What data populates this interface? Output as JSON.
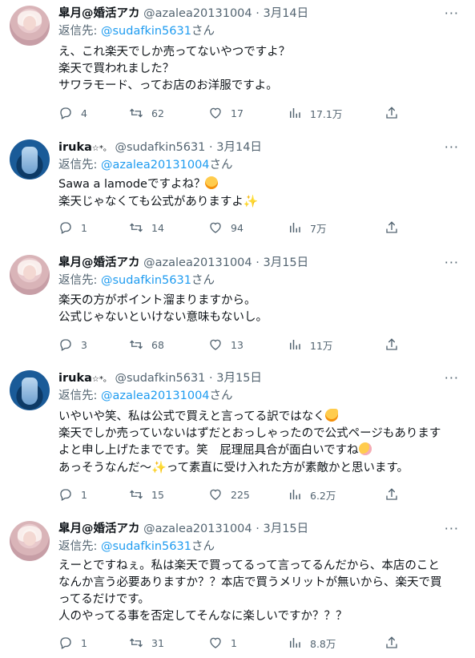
{
  "tweets": [
    {
      "name": "皐月@婚活アカ",
      "handle": "@azalea20131004",
      "date": "3月14日",
      "reply_prefix": "返信先: ",
      "reply_to": "@sudafkin5631",
      "reply_suffix": "さん",
      "lines": [
        "え、これ楽天でしか売ってないやつですよ？",
        "楽天で買われました？",
        "サワラモード、ってお店のお洋服ですよ。"
      ],
      "replies": "4",
      "retweets": "62",
      "likes": "17",
      "views": "17.1万"
    },
    {
      "name": "iruka",
      "name_suffix": "☆*。",
      "handle": "@sudafkin5631",
      "date": "3月14日",
      "reply_prefix": "返信先: ",
      "reply_to": "@azalea20131004",
      "reply_suffix": "さん",
      "lines": [
        "Sawa a lamodeですよね？",
        "楽天じゃなくても公式がありますよ"
      ],
      "replies": "1",
      "retweets": "14",
      "likes": "94",
      "views": "7万"
    },
    {
      "name": "皐月@婚活アカ",
      "handle": "@azalea20131004",
      "date": "3月15日",
      "reply_prefix": "返信先: ",
      "reply_to": "@sudafkin5631",
      "reply_suffix": "さん",
      "lines": [
        "楽天の方がポイント溜まりますから。",
        "公式じゃないといけない意味もないし。"
      ],
      "replies": "3",
      "retweets": "68",
      "likes": "13",
      "views": "11万"
    },
    {
      "name": "iruka",
      "name_suffix": "☆*。",
      "handle": "@sudafkin5631",
      "date": "3月15日",
      "reply_prefix": "返信先: ",
      "reply_to": "@azalea20131004",
      "reply_suffix": "さん",
      "lines": [
        "いやいや笑、私は公式で買えと言ってる訳ではなく",
        "楽天でしか売っていないはずだとおっしゃったので公式ページもあります",
        "よと申し上げたまでです。笑　屁理屈具合が面白いですね",
        "あっそうなんだ～",
        "って素直に受け入れた方が素敵かと思います。"
      ],
      "replies": "1",
      "retweets": "15",
      "likes": "225",
      "views": "6.2万"
    },
    {
      "name": "皐月@婚活アカ",
      "handle": "@azalea20131004",
      "date": "3月15日",
      "reply_prefix": "返信先: ",
      "reply_to": "@sudafkin5631",
      "reply_suffix": "さん",
      "lines": [
        "えーとですねぇ。私は楽天で買ってるって言ってるんだから、本店のこと",
        "なんか言う必要ありますか？？本店で買うメリットが無いから、楽天で買",
        "ってるだけです。",
        "人のやってる事を否定してそんなに楽しいですか？？？"
      ],
      "replies": "1",
      "retweets": "31",
      "likes": "1",
      "views": "8.8万"
    }
  ],
  "icons": {
    "more": "more-icon",
    "reply": "reply-icon",
    "retweet": "retweet-icon",
    "like": "heart-icon",
    "views": "views-icon",
    "share": "share-icon"
  },
  "colors": {
    "link": "#1d9bf0",
    "secondary": "#536471",
    "text": "#0f1419"
  }
}
